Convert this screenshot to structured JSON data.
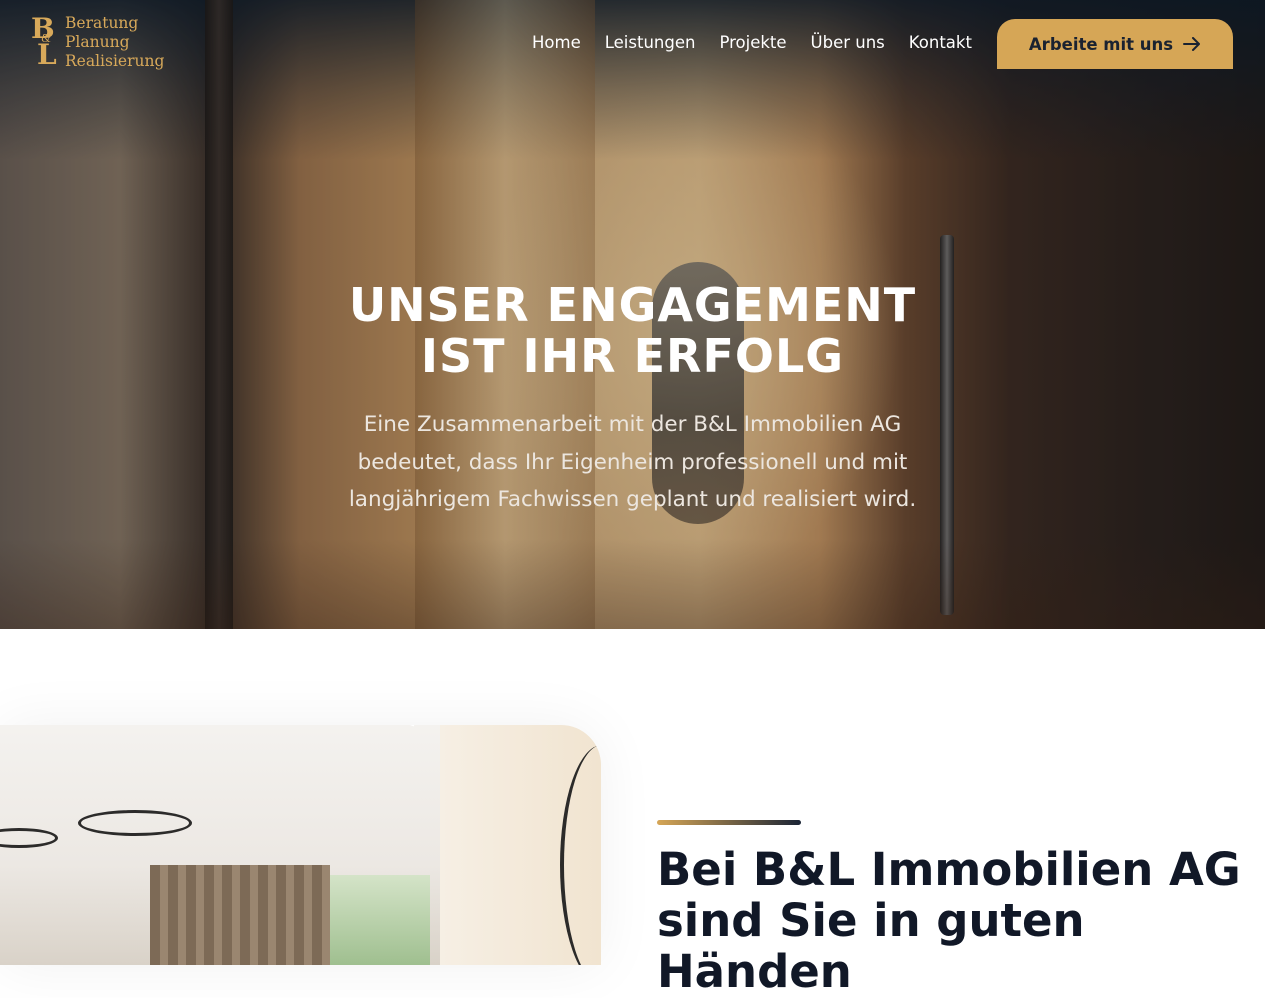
{
  "header": {
    "logo": {
      "mark_b": "B",
      "mark_amp": "&",
      "mark_l": "L",
      "lines": [
        "Beratung",
        "Planung",
        "Realisierung"
      ]
    },
    "nav": [
      {
        "label": "Home"
      },
      {
        "label": "Leistungen"
      },
      {
        "label": "Projekte"
      },
      {
        "label": "Über uns"
      },
      {
        "label": "Kontakt"
      }
    ],
    "cta": {
      "label": "Arbeite mit uns",
      "icon": "arrow-right-icon"
    }
  },
  "hero": {
    "title_line1": "UNSER ENGAGEMENT",
    "title_line2": "IST IHR ERFOLG",
    "subtitle_line1": "Eine Zusammenarbeit mit der B&L Immobilien AG",
    "subtitle_line2": "bedeutet, dass Ihr Eigenheim professionell und mit",
    "subtitle_line3": "langjährigem Fachwissen geplant und realisiert wird."
  },
  "about": {
    "title_line1": "Bei B&L Immobilien AG",
    "title_line2": "sind Sie in guten",
    "title_line3": "Händen"
  },
  "colors": {
    "accent": "#d6a656",
    "dark": "#111827"
  }
}
